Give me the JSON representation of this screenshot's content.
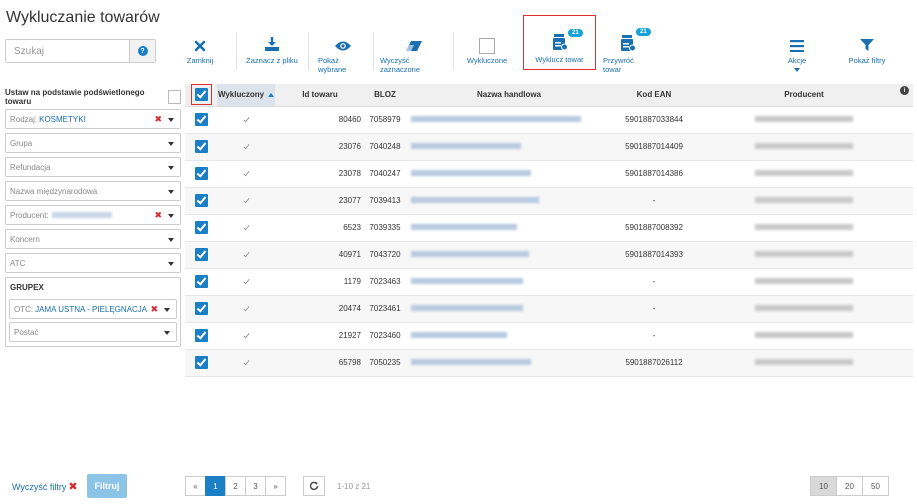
{
  "page": {
    "title": "Wykluczanie towarów"
  },
  "search": {
    "placeholder": "Szukaj",
    "help_icon": "question-circle-icon"
  },
  "filters": {
    "highlighted_label": "Ustaw na podstawie podświetlonego towaru",
    "rodzaj": {
      "label": "Rodzaj:",
      "value": "KOSMETYKI"
    },
    "grupa": {
      "label": "Grupa"
    },
    "refundacja": {
      "label": "Refundacja"
    },
    "nazwa_miedzynarodowa": {
      "label": "Nazwa międzynarodowa"
    },
    "producent": {
      "label": "Producent:"
    },
    "koncern": {
      "label": "Koncern"
    },
    "atc": {
      "label": "ATC"
    },
    "grupex": {
      "label": "GRUPEX",
      "otc": {
        "label": "OTC:",
        "value": "JAMA USTNA - PIELĘGNACJA"
      },
      "postac": {
        "label": "Postać"
      }
    }
  },
  "toolbar": {
    "zamknij": "Zamknij",
    "zaznacz_z_pliku": "Zaznacz z pliku",
    "pokaz_wybrane": "Pokaż wybrane",
    "wyczysc_zaznaczone": "Wyczyść zaznaczone",
    "wykluczone": "Wykluczone",
    "wyklucz_towar": "Wyklucz towar",
    "wyklucz_badge": "21",
    "przywroc_towar": "Przywróć towar",
    "przywroc_badge": "21",
    "akcje": "Akcje",
    "pokaz_filtry": "Pokaż filtry"
  },
  "table": {
    "columns": [
      "Wykluczony",
      "Id towaru",
      "BLOZ",
      "Nazwa handlowa",
      "Kod EAN",
      "Producent"
    ],
    "rows": [
      {
        "id": "80460",
        "bloz": "7058979",
        "ean": "5901887033844"
      },
      {
        "id": "23076",
        "bloz": "7040248",
        "ean": "5901887014409"
      },
      {
        "id": "23078",
        "bloz": "7040247",
        "ean": "5901887014386"
      },
      {
        "id": "23077",
        "bloz": "7039413",
        "ean": "-"
      },
      {
        "id": "6523",
        "bloz": "7039335",
        "ean": "5901887008392"
      },
      {
        "id": "40971",
        "bloz": "7043720",
        "ean": "5901887014393"
      },
      {
        "id": "1179",
        "bloz": "7023463",
        "ean": "-"
      },
      {
        "id": "20474",
        "bloz": "7023461",
        "ean": "-"
      },
      {
        "id": "21927",
        "bloz": "7023460",
        "ean": "-"
      },
      {
        "id": "65798",
        "bloz": "7050235",
        "ean": "5901887026112"
      }
    ]
  },
  "footer": {
    "clear_filters": "Wyczyść filtry",
    "filter_button": "Filtruj",
    "pages": [
      "«",
      "1",
      "2",
      "3",
      "»"
    ],
    "active_page": "1",
    "pager_info": "1-10 z 21",
    "page_sizes": [
      "10",
      "20",
      "50"
    ],
    "active_size": "10"
  },
  "colors": {
    "accent": "#1a7fc4",
    "highlight_border": "#e03030",
    "badge": "#17a2d8"
  }
}
